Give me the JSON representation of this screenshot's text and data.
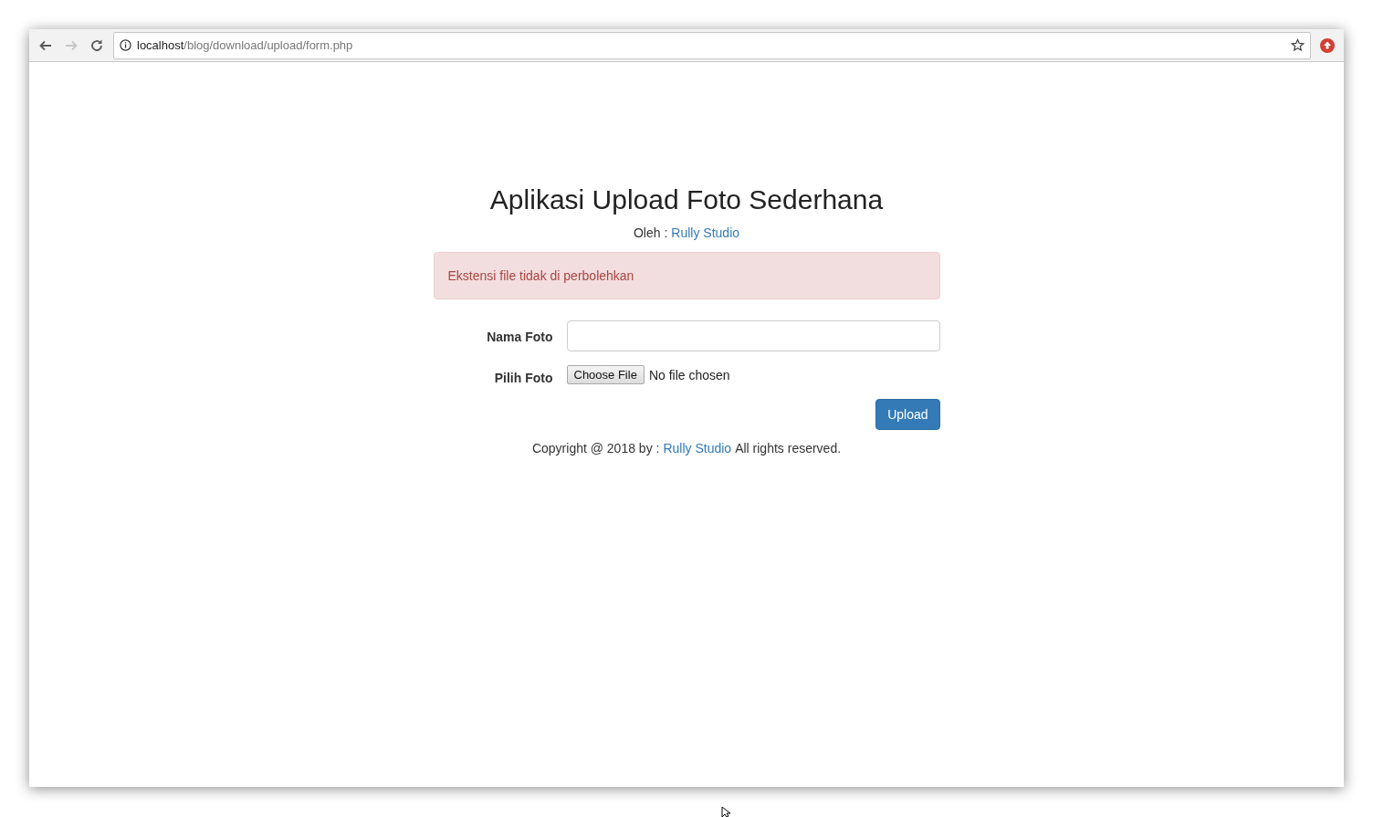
{
  "browser": {
    "nav_buttons": [
      {
        "kind": "back",
        "disabled": false
      },
      {
        "kind": "forward",
        "disabled": true
      },
      {
        "kind": "reload",
        "disabled": false
      }
    ],
    "url": {
      "host": "localhost",
      "path": "/blog/download/upload/form.php"
    }
  },
  "page": {
    "title": "Aplikasi Upload Foto Sederhana",
    "byline": {
      "label": "Oleh :",
      "link": "Rully Studio"
    },
    "alert": "Ekstensi file tidak di perbolehkan",
    "fields": [
      {
        "kind": "text",
        "label": "Nama Foto"
      },
      {
        "kind": "file",
        "label": "Pilih Foto",
        "button": "Choose File",
        "status": "No file chosen"
      }
    ],
    "submit": "Upload",
    "footer": {
      "before": "Copyright @ 2018 by :",
      "link": "Rully Studio",
      "after": "All rights reserved."
    }
  }
}
